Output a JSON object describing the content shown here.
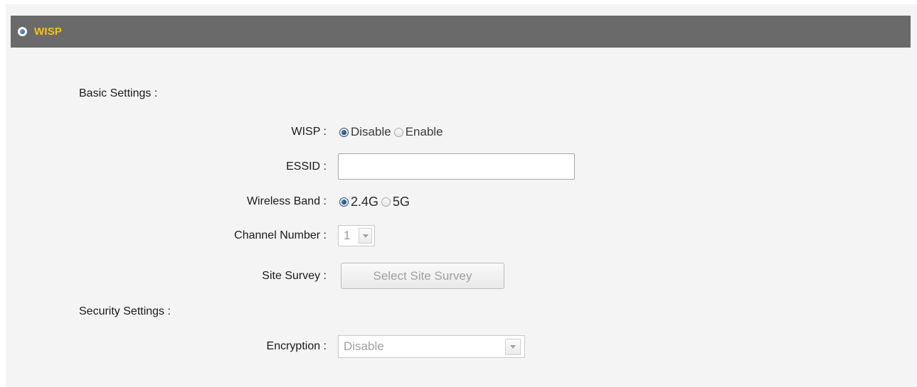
{
  "header": {
    "title": "WISP"
  },
  "sections": {
    "basic_label": "Basic Settings :",
    "security_label": "Security Settings :"
  },
  "fields": {
    "wisp": {
      "label": "WISP :",
      "options": [
        "Disable",
        "Enable"
      ],
      "selected": "Disable"
    },
    "essid": {
      "label": "ESSID :",
      "value": ""
    },
    "wireless_band": {
      "label": "Wireless Band :",
      "options": [
        "2.4G",
        "5G"
      ],
      "selected": "2.4G"
    },
    "channel_number": {
      "label": "Channel Number :",
      "value": "1"
    },
    "site_survey": {
      "label": "Site Survey :",
      "button_label": "Select Site Survey"
    },
    "encryption": {
      "label": "Encryption :",
      "value": "Disable"
    }
  },
  "colors": {
    "header_bg": "#6a6a6a",
    "header_title": "#f3c21b",
    "panel_bg": "#f4f4f4"
  }
}
